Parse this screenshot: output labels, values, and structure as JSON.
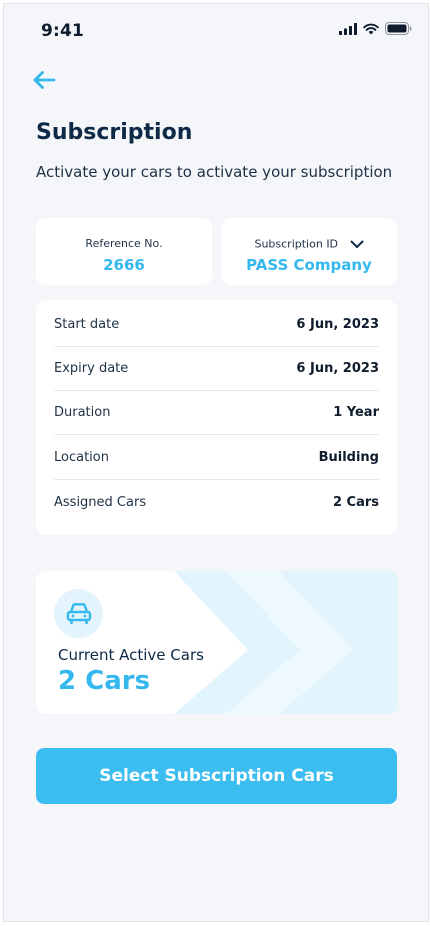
{
  "status_bar": {
    "time": "9:41"
  },
  "header": {
    "title": "Subscription",
    "subtitle": "Activate your cars to activate your subscription"
  },
  "reference": {
    "label": "Reference No.",
    "value": "2666"
  },
  "subscription": {
    "label": "Subscription ID",
    "value": "PASS Company"
  },
  "details": [
    {
      "label": "Start date",
      "value": "6 Jun, 2023"
    },
    {
      "label": "Expiry date",
      "value": "6 Jun, 2023"
    },
    {
      "label": "Duration",
      "value": "1 Year"
    },
    {
      "label": "Location",
      "value": "Building"
    },
    {
      "label": "Assigned Cars",
      "value": "2 Cars"
    }
  ],
  "active_cars": {
    "label": "Current Active Cars",
    "value": "2 Cars"
  },
  "cta": {
    "label": "Select Subscription Cars"
  },
  "icons": [
    "back-arrow-icon",
    "signal-icon",
    "wifi-icon",
    "battery-icon",
    "chevron-down-icon",
    "car-icon"
  ],
  "colors": {
    "accent": "#35b8ee",
    "button": "#3bbdef",
    "text": "#0f2a47",
    "background": "#f4f6f9"
  }
}
